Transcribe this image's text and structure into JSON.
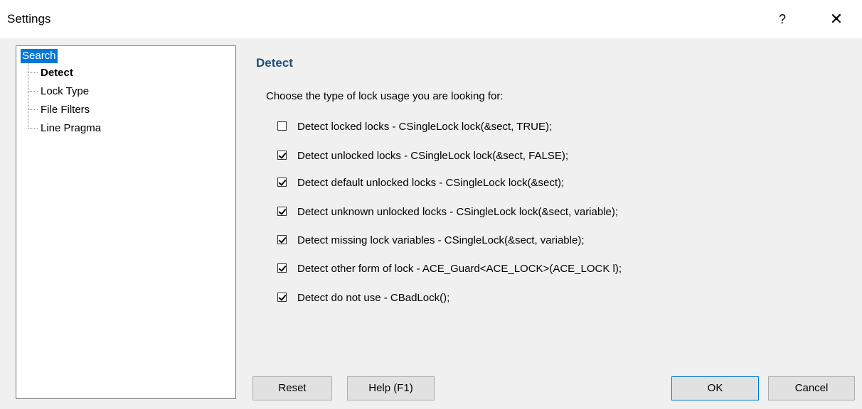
{
  "window": {
    "title": "Settings",
    "help": "?",
    "close": "✕"
  },
  "tree": {
    "root": "Search",
    "items": [
      "Detect",
      "Lock Type",
      "File Filters",
      "Line Pragma"
    ]
  },
  "panel": {
    "heading": "Detect",
    "description": "Choose the type of lock usage you are looking for:",
    "options": [
      {
        "label": "Detect locked locks - CSingleLock lock(&sect, TRUE);",
        "checked": false
      },
      {
        "label": "Detect unlocked locks - CSingleLock lock(&sect, FALSE);",
        "checked": true
      },
      {
        "label": "Detect default unlocked locks - CSingleLock lock(&sect);",
        "checked": true
      },
      {
        "label": "Detect unknown unlocked locks - CSingleLock lock(&sect, variable);",
        "checked": true
      },
      {
        "label": "Detect missing lock variables - CSingleLock(&sect, variable);",
        "checked": true
      },
      {
        "label": "Detect other form of lock - ACE_Guard<ACE_LOCK>(ACE_LOCK l);",
        "checked": true
      },
      {
        "label": "Detect do not use - CBadLock();",
        "checked": true
      }
    ]
  },
  "buttons": {
    "reset": "Reset",
    "help": "Help (F1)",
    "ok": "OK",
    "cancel": "Cancel"
  }
}
